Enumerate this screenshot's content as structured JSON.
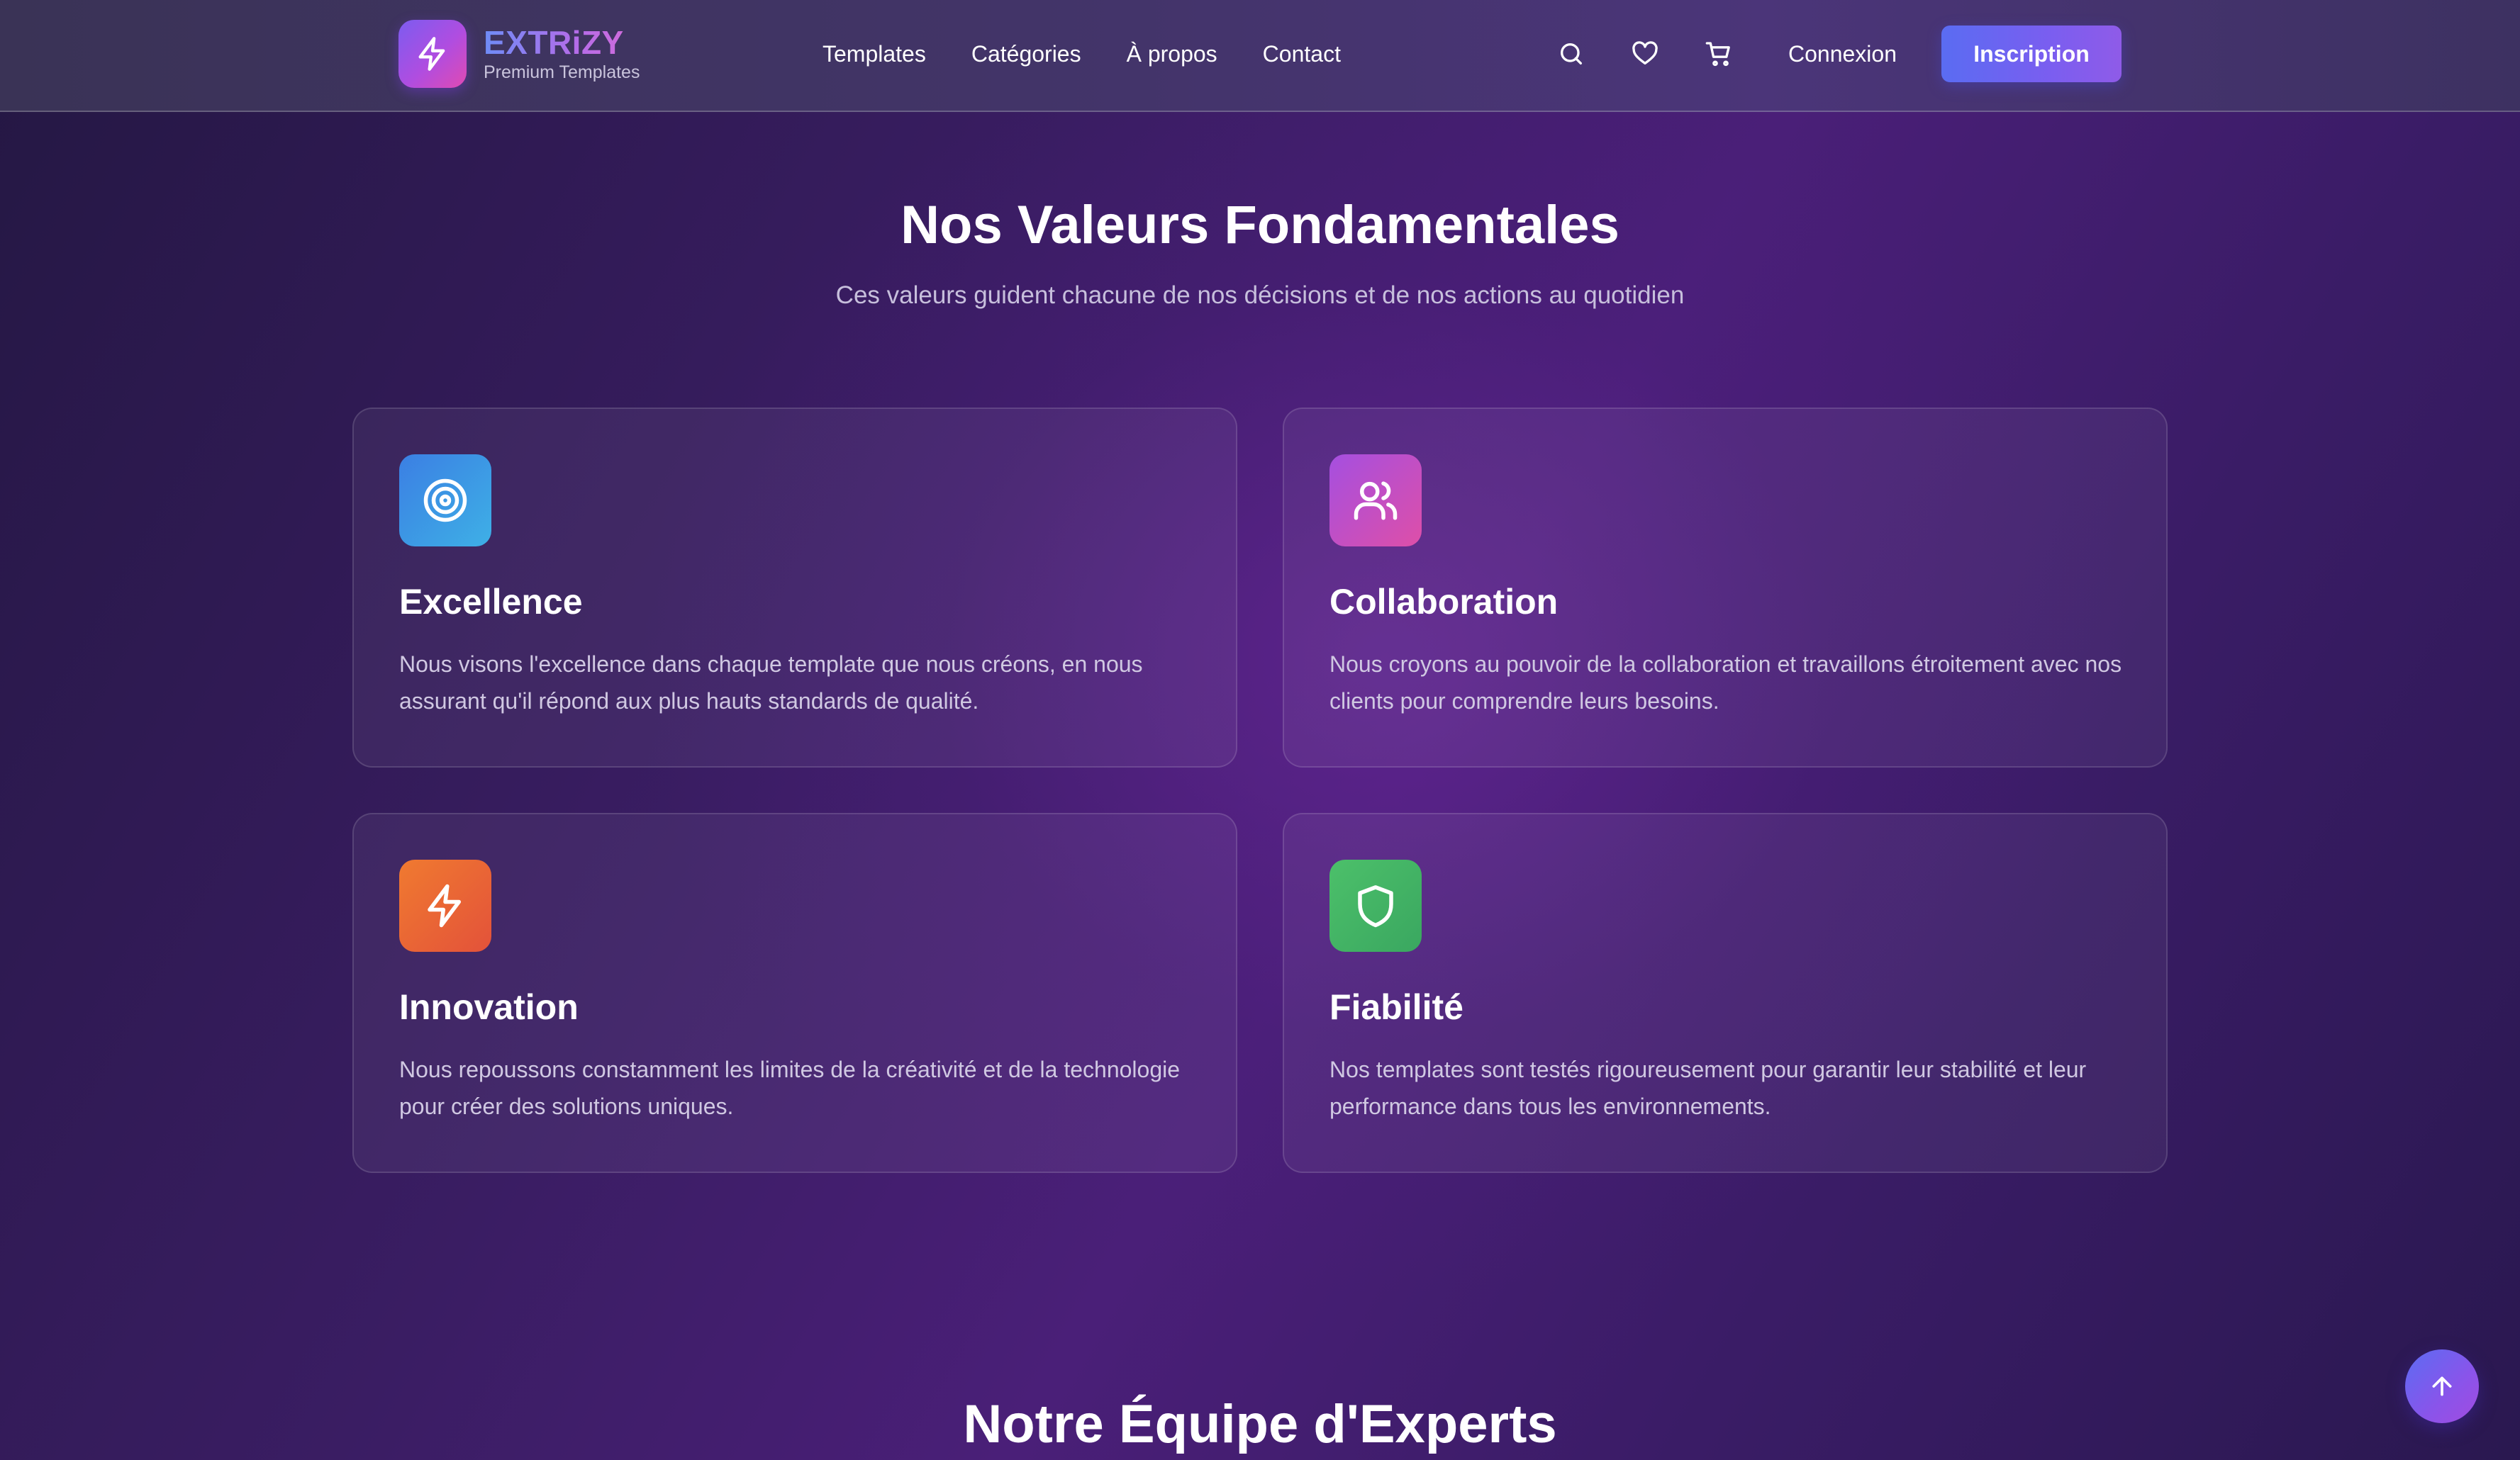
{
  "header": {
    "logo": {
      "name": "EXTRiZY",
      "subtitle": "Premium Templates",
      "icon": "lightning-icon"
    },
    "nav": [
      {
        "label": "Templates"
      },
      {
        "label": "Catégories"
      },
      {
        "label": "À propos"
      },
      {
        "label": "Contact"
      }
    ],
    "icons": [
      "search-icon",
      "heart-icon",
      "cart-icon"
    ],
    "login_label": "Connexion",
    "signup_label": "Inscription"
  },
  "values_section": {
    "title": "Nos Valeurs Fondamentales",
    "subtitle": "Ces valeurs guident chacune de nos décisions et de nos actions au quotidien",
    "cards": [
      {
        "title": "Excellence",
        "description": "Nous visons l'excellence dans chaque template que nous créons, en nous assurant qu'il répond aux plus hauts standards de qualité.",
        "icon": "target-icon",
        "color": "#3f8fe6"
      },
      {
        "title": "Collaboration",
        "description": "Nous croyons au pouvoir de la collaboration et travaillons étroitement avec nos clients pour comprendre leurs besoins.",
        "icon": "users-icon",
        "color": "#c04fd8"
      },
      {
        "title": "Innovation",
        "description": "Nous repoussons constamment les limites de la créativité et de la technologie pour créer des solutions uniques.",
        "icon": "lightning-icon",
        "color": "#ec6a2c"
      },
      {
        "title": "Fiabilité",
        "description": "Nos templates sont testés rigoureusement pour garantir leur stabilité et leur performance dans tous les environnements.",
        "icon": "shield-icon",
        "color": "#46b96a"
      }
    ]
  },
  "team_section": {
    "title": "Notre Équipe d'Experts"
  },
  "scroll_top": {
    "icon": "arrow-up-icon"
  },
  "colors": {
    "accent": "#6a63f0",
    "background": "#3a1d63"
  }
}
